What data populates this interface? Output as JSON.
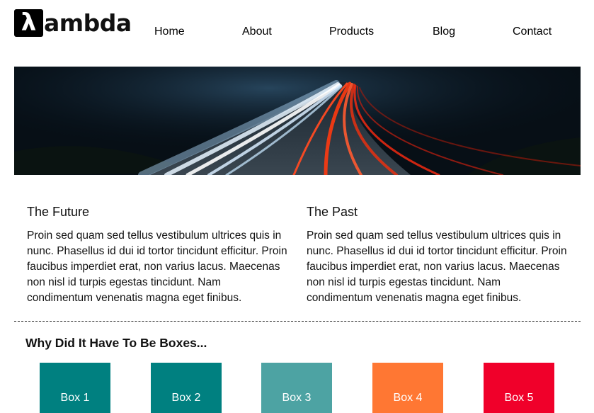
{
  "header": {
    "logo_mark": "λ",
    "logo_text": "ambda",
    "nav": [
      "Home",
      "About",
      "Products",
      "Blog",
      "Contact"
    ]
  },
  "sections": [
    {
      "title": "The Future",
      "body": "Proin sed quam sed tellus vestibulum ultrices quis in nunc. Phasellus id dui id tortor tincidunt efficitur. Proin faucibus imperdiet erat, non varius lacus. Maecenas non nisl id turpis egestas tincidunt. Nam condimentum venenatis magna eget finibus."
    },
    {
      "title": "The Past",
      "body": "Proin sed quam sed tellus vestibulum ultrices quis in nunc. Phasellus id dui id tortor tincidunt efficitur. Proin faucibus imperdiet erat, non varius lacus. Maecenas non nisl id turpis egestas tincidunt. Nam condimentum venenatis magna eget finibus."
    }
  ],
  "boxes_title": "Why Did It Have To Be Boxes...",
  "boxes": [
    {
      "label": "Box 1",
      "color": "#008080"
    },
    {
      "label": "Box 2",
      "color": "#008080"
    },
    {
      "label": "Box 3",
      "color": "#4da3a3"
    },
    {
      "label": "Box 4",
      "color": "#ff7733"
    },
    {
      "label": "Box 5",
      "color": "#f0002a"
    }
  ]
}
